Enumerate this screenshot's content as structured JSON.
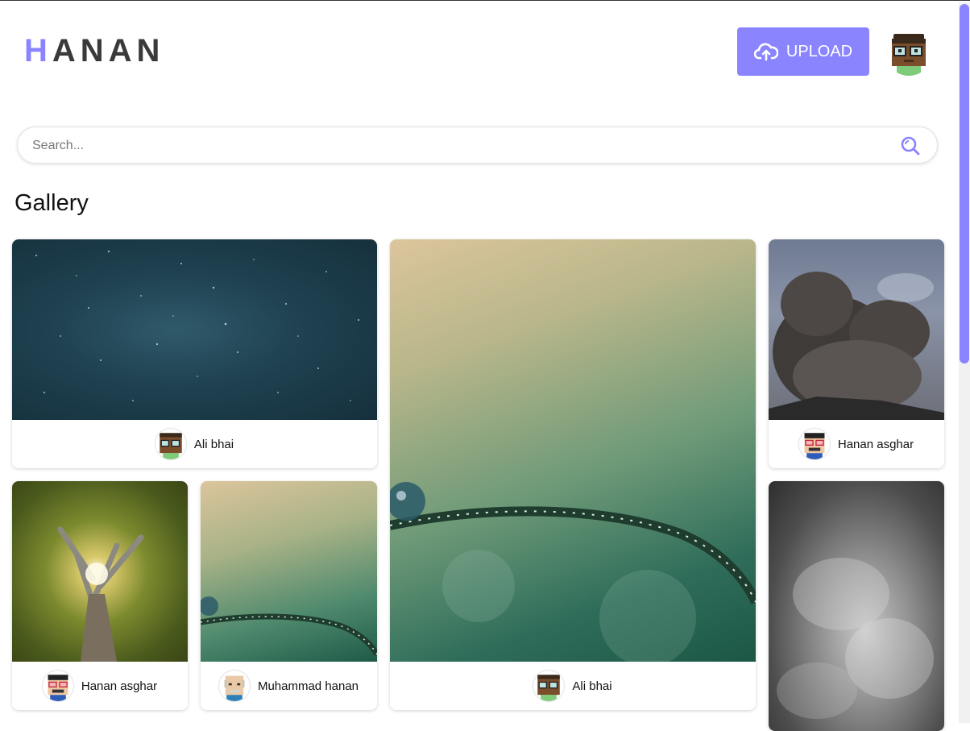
{
  "header": {
    "logo_first": "H",
    "logo_rest": "ANAN",
    "upload_label": "UPLOAD"
  },
  "search": {
    "placeholder": "Search..."
  },
  "gallery": {
    "title": "Gallery",
    "cards": [
      {
        "image": "starry-night-sky",
        "user": "Ali bhai",
        "avatar": "brown-glasses"
      },
      {
        "image": "dewdrop-plant-large",
        "user": "Ali bhai",
        "avatar": "brown-glasses"
      },
      {
        "image": "volcano-ash-cloud",
        "user": "Hanan asghar",
        "avatar": "red-glasses"
      },
      {
        "image": "sunlit-tree",
        "user": "Hanan asghar",
        "avatar": "red-glasses"
      },
      {
        "image": "dewdrop-plant-small",
        "user": "Muhammad hanan",
        "avatar": "bald-man"
      },
      {
        "image": "grey-clouds",
        "user": "",
        "avatar": ""
      }
    ]
  },
  "colors": {
    "accent": "#8a84ff",
    "text": "#222222"
  },
  "icons": [
    "cloud-upload-icon",
    "search-icon"
  ]
}
